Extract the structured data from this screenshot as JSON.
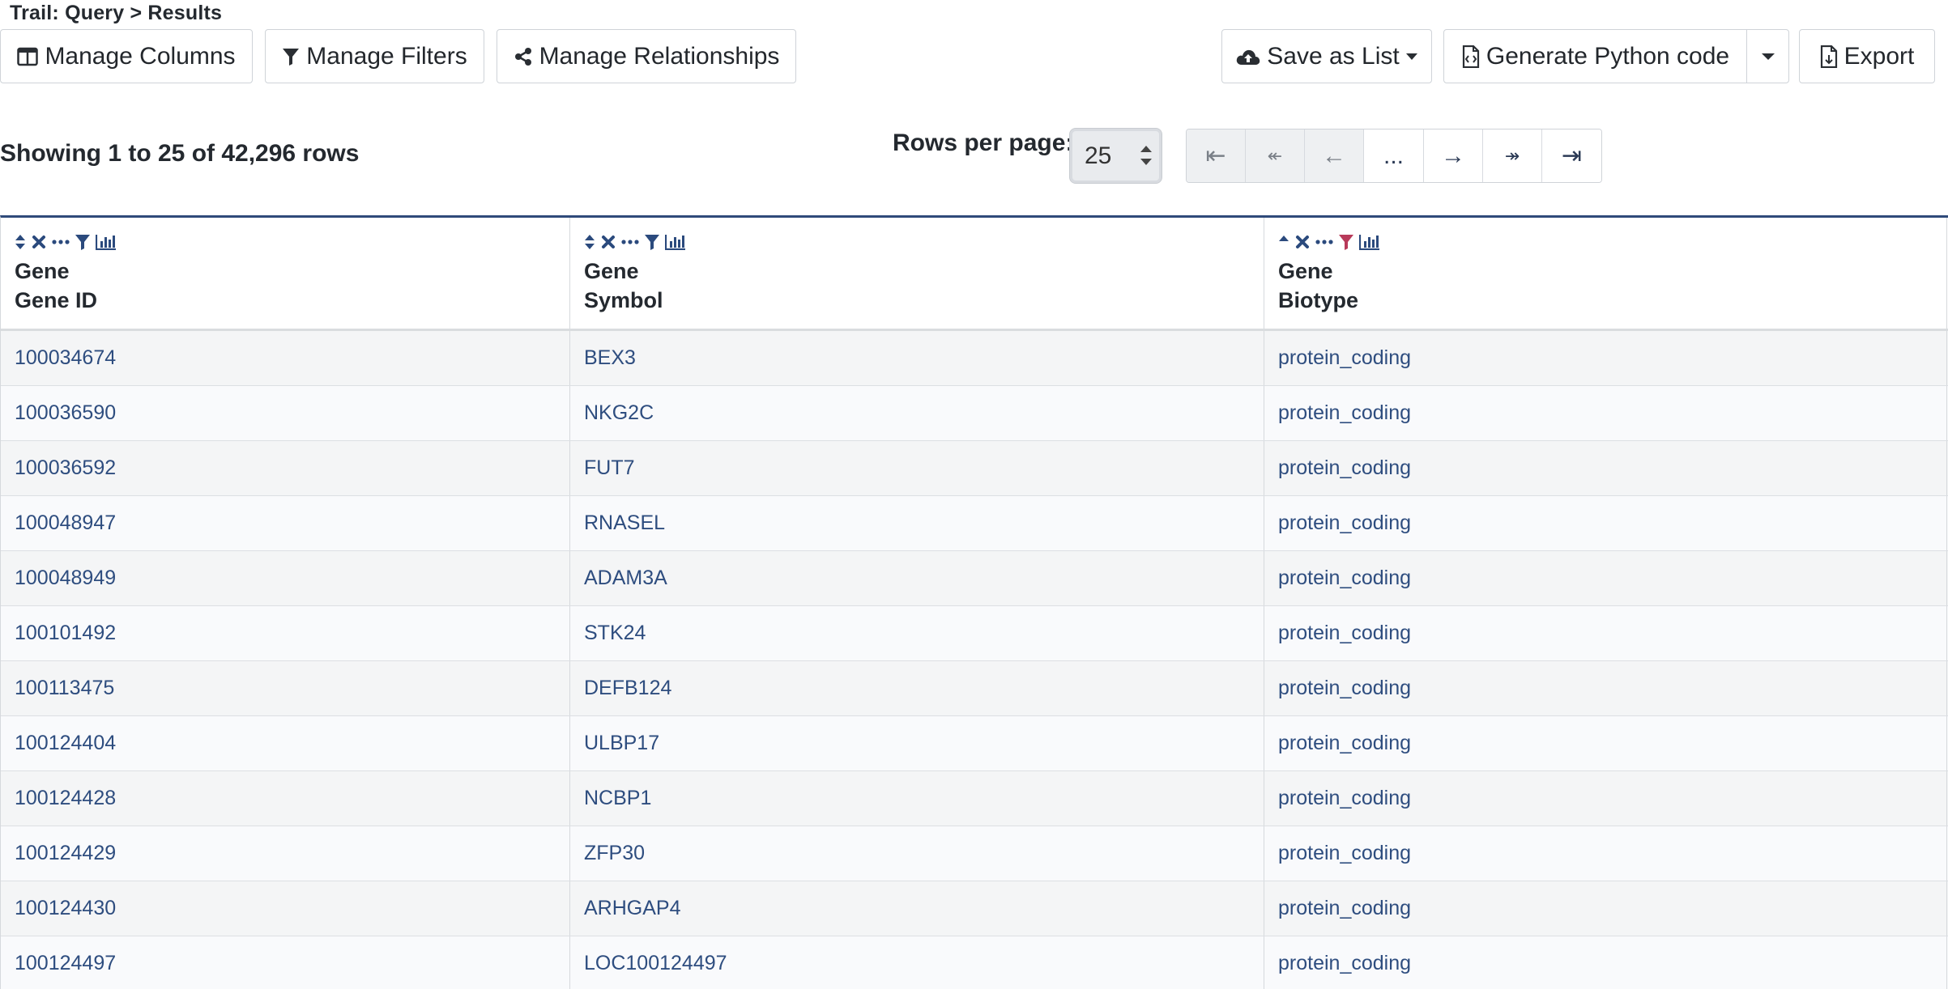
{
  "breadcrumb": "Trail: Query > Results",
  "toolbar": {
    "manage_columns": "Manage Columns",
    "manage_filters": "Manage Filters",
    "manage_relationships": "Manage Relationships",
    "save_as_list": "Save as List",
    "generate_python": "Generate Python code",
    "export": "Export"
  },
  "status": {
    "showing": "Showing 1 to 25 of 42,296 rows",
    "rows_per_page_label": "Rows per page:",
    "rows_per_page_value": "25"
  },
  "pagination": {
    "first": "⇤",
    "prev_many": "↞",
    "prev": "←",
    "ellipsis": "...",
    "next": "→",
    "next_many": "↠",
    "last": "⇥"
  },
  "columns": [
    {
      "line1": "Gene",
      "line2": "Gene ID"
    },
    {
      "line1": "Gene",
      "line2": "Symbol"
    },
    {
      "line1": "Gene",
      "line2": "Biotype"
    }
  ],
  "rows": [
    [
      "100034674",
      "BEX3",
      "protein_coding"
    ],
    [
      "100036590",
      "NKG2C",
      "protein_coding"
    ],
    [
      "100036592",
      "FUT7",
      "protein_coding"
    ],
    [
      "100048947",
      "RNASEL",
      "protein_coding"
    ],
    [
      "100048949",
      "ADAM3A",
      "protein_coding"
    ],
    [
      "100101492",
      "STK24",
      "protein_coding"
    ],
    [
      "100113475",
      "DEFB124",
      "protein_coding"
    ],
    [
      "100124404",
      "ULBP17",
      "protein_coding"
    ],
    [
      "100124428",
      "NCBP1",
      "protein_coding"
    ],
    [
      "100124429",
      "ZFP30",
      "protein_coding"
    ],
    [
      "100124430",
      "ARHGAP4",
      "protein_coding"
    ],
    [
      "100124497",
      "LOC100124497",
      "protein_coding"
    ]
  ],
  "colors": {
    "link": "#2e4d7f",
    "header_rule": "#2f4a7a",
    "icon": "#2b4a7d",
    "active_filter": "#b83a5a"
  }
}
